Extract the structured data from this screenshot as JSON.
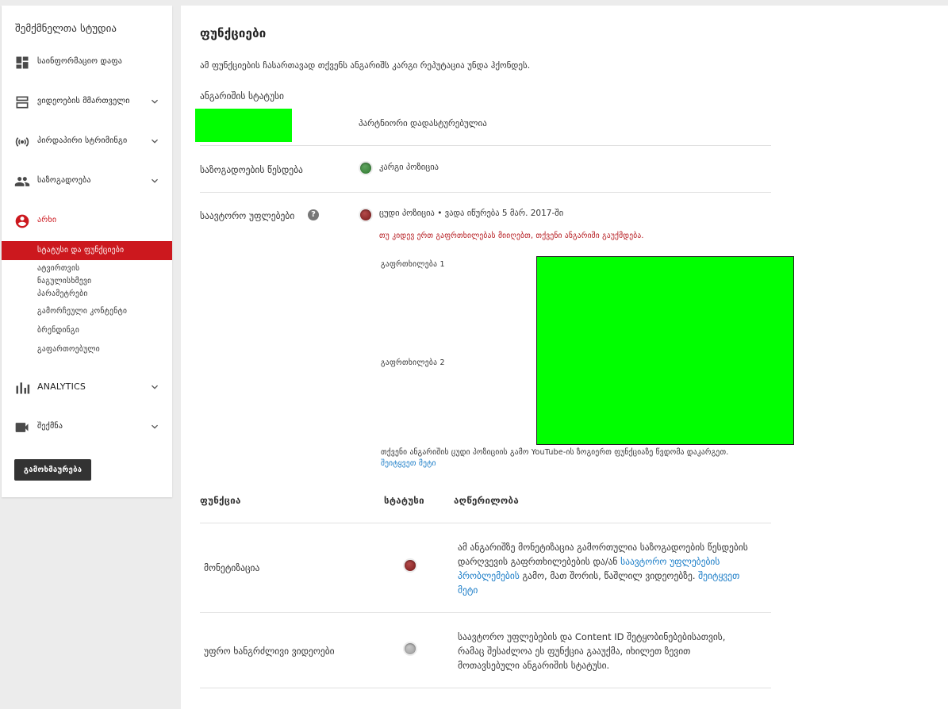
{
  "sidebar": {
    "title": "შემქმნელთა სტუდია",
    "items": [
      {
        "label": "საინფორმაციო დაფა",
        "icon": "dashboard-icon",
        "chevron": false
      },
      {
        "label": "ვიდეოების მმართველი",
        "icon": "video-manager-icon",
        "chevron": true
      },
      {
        "label": "პირდაპირი სტრიმინგი",
        "icon": "live-streaming-icon",
        "chevron": true
      },
      {
        "label": "საზოგადოება",
        "icon": "community-icon",
        "chevron": true
      },
      {
        "label": "არხი",
        "icon": "channel-icon",
        "chevron": false,
        "active": true
      },
      {
        "label": "ANALYTICS",
        "icon": "analytics-icon",
        "chevron": true
      },
      {
        "label": "შექმნა",
        "icon": "create-icon",
        "chevron": true
      }
    ],
    "channel_sub": {
      "active": "სტატუსი და ფუნქციები",
      "defaults_lines": [
        "ატვირთვის",
        "ნაგულისხმევი",
        "პარამეტრები"
      ],
      "featured": "გამორჩეული კონტენტი",
      "branding": "ბრენდინგი",
      "advanced": "გაფართოებული"
    },
    "feedback_button": "გამოხმაურება"
  },
  "main": {
    "title": "ფუნქციები",
    "intro": "ამ ფუნქციების ჩასართავად თქვენს ანგარიშს კარგი რეპუტაცია უნდა ჰქონდეს.",
    "account_status_label": "ანგარიშის სტატუსი",
    "partner_status": "პარტნიორი დადასტურებულია",
    "community_guidelines": {
      "label": "საზოგადოების წესდება",
      "status": "კარგი პოზიცია"
    },
    "copyright": {
      "label": "საავტორო უფლებები",
      "status": "ცუდი პოზიცია • ვადა იწურება 5 მარ. 2017-ში",
      "warning": "თუ კიდევ ერთ გაფრთხილებას მიიღებთ, თქვენი ანგარიში გაუქმდება.",
      "strike1": "გაფრთხილება 1",
      "strike2": "გაფრთხილება 2",
      "note": "თქვენი ანგარიშის ცუდი პოზიციის გამო YouTube-ის ზოგიერთ ფუნქციაზე წვდომა დაკარგეთ.",
      "learn_more": "შეიტყვეთ მეტი"
    },
    "table": {
      "headers": {
        "feature": "ფუნქცია",
        "status": "სტატუსი",
        "description": "აღწერილობა"
      },
      "rows": [
        {
          "feature": "მონეტიზაცია",
          "status_color": "#8b2a2a",
          "desc_before": "ამ ანგარიშზე მონეტიზაცია გამორთულია საზოგადოების წესდების დარღვევის გაფრთხილებების და/ან ",
          "desc_link": "საავტორო უფლებების პრობლემების",
          "desc_after": " გამო, მათ შორის, წაშლილ ვიდეოებზე. ",
          "learn_more": "შეიტყვეთ მეტი"
        },
        {
          "feature": "უფრო ხანგრძლივი ვიდეოები",
          "status_color": "#a8a8a8",
          "description": "საავტორო უფლებების და Content ID შეტყობინებებისათვის, რამაც შესაძლოა ეს ფუნქცია გააუქმა, იხილეთ ზევით მოთავსებული ანგარიშის სტატუსი."
        }
      ]
    }
  },
  "colors": {
    "accent": "#cc181e",
    "link": "#167ac6",
    "placeholder_green": "#00ff00"
  }
}
